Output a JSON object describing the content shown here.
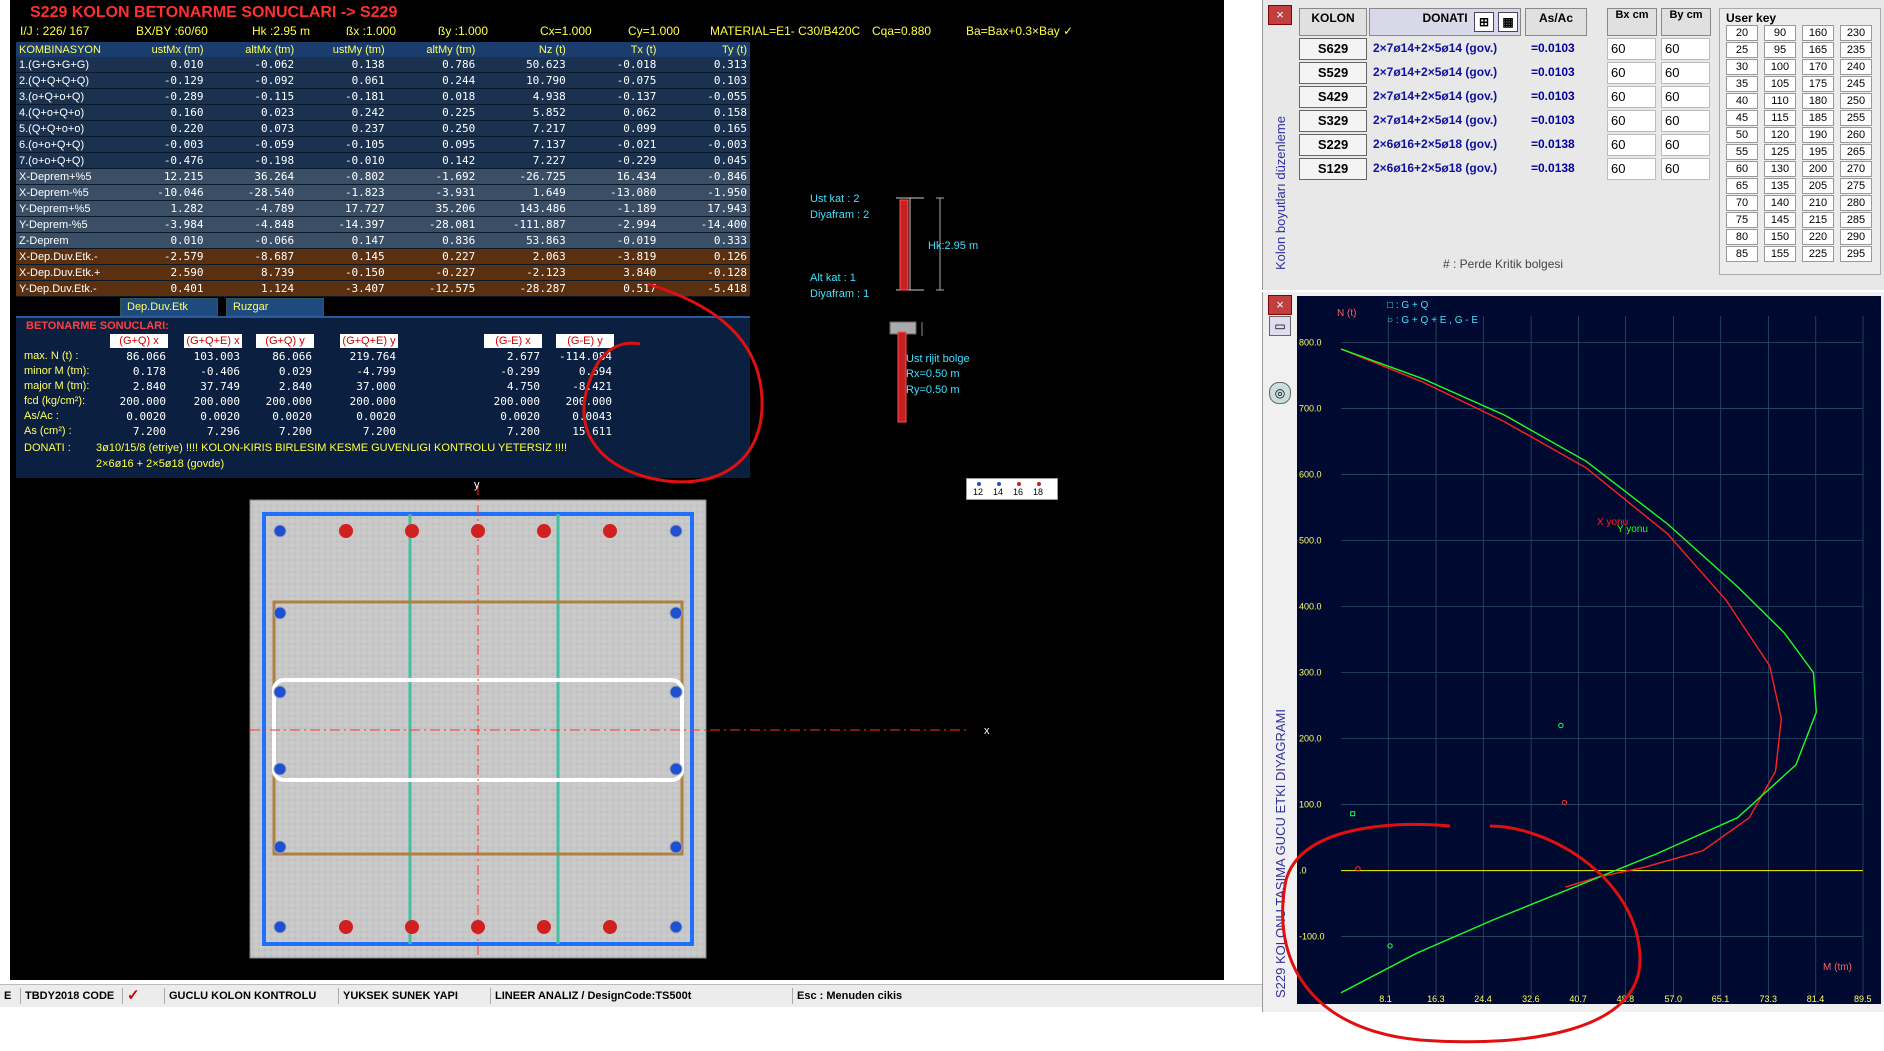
{
  "header": {
    "title": "S229 KOLON BETONARME SONUCLARI  ->  S229",
    "info": [
      "I/J : 226/ 167",
      "BX/BY :60/60",
      "Hk :2.95 m",
      "ßx :1.000",
      "ßy :1.000",
      "Cx=1.000",
      "Cy=1.000",
      "MATERIAL=E1-  C30/B420C",
      "Cqa=0.880",
      "Ba=Bax+0.3×Bay  ✓"
    ]
  },
  "combo_table": {
    "headers": [
      "KOMBINASYON",
      "ustMx (tm)",
      "altMx (tm)",
      "ustMy (tm)",
      "altMy (tm)",
      "Nz (t)",
      "Tx (t)",
      "Ty (t)"
    ],
    "rows": [
      {
        "cells": [
          "1.(G+G+G+G)",
          "0.010",
          "-0.062",
          "0.138",
          "0.786",
          "50.623",
          "-0.018",
          "0.313"
        ],
        "group": "a"
      },
      {
        "cells": [
          "2.(Q+Q+Q+Q)",
          "-0.129",
          "-0.092",
          "0.061",
          "0.244",
          "10.790",
          "-0.075",
          "0.103"
        ],
        "group": "a"
      },
      {
        "cells": [
          "3.(o+Q+o+Q)",
          "-0.289",
          "-0.115",
          "-0.181",
          "0.018",
          "4.938",
          "-0.137",
          "-0.055"
        ],
        "group": "a"
      },
      {
        "cells": [
          "4.(Q+o+Q+o)",
          "0.160",
          "0.023",
          "0.242",
          "0.225",
          "5.852",
          "0.062",
          "0.158"
        ],
        "group": "a"
      },
      {
        "cells": [
          "5.(Q+Q+o+o)",
          "0.220",
          "0.073",
          "0.237",
          "0.250",
          "7.217",
          "0.099",
          "0.165"
        ],
        "group": "a"
      },
      {
        "cells": [
          "6.(o+o+Q+Q)",
          "-0.003",
          "-0.059",
          "-0.105",
          "0.095",
          "7.137",
          "-0.021",
          "-0.003"
        ],
        "group": "a"
      },
      {
        "cells": [
          "7.(o+o+Q+Q)",
          "-0.476",
          "-0.198",
          "-0.010",
          "0.142",
          "7.227",
          "-0.229",
          "0.045"
        ],
        "group": "a"
      },
      {
        "cells": [
          "X-Deprem+%5",
          "12.215",
          "36.264",
          "-0.802",
          "-1.692",
          "-26.725",
          "16.434",
          "-0.846"
        ],
        "group": "b"
      },
      {
        "cells": [
          "X-Deprem-%5",
          "-10.046",
          "-28.540",
          "-1.823",
          "-3.931",
          "1.649",
          "-13.080",
          "-1.950"
        ],
        "group": "b"
      },
      {
        "cells": [
          "Y-Deprem+%5",
          "1.282",
          "-4.789",
          "17.727",
          "35.206",
          "143.486",
          "-1.189",
          "17.943"
        ],
        "group": "b"
      },
      {
        "cells": [
          "Y-Deprem-%5",
          "-3.984",
          "-4.848",
          "-14.397",
          "-28.081",
          "-111.887",
          "-2.994",
          "-14.400"
        ],
        "group": "b"
      },
      {
        "cells": [
          "Z-Deprem",
          "0.010",
          "-0.066",
          "0.147",
          "0.836",
          "53.863",
          "-0.019",
          "0.333"
        ],
        "group": "b"
      },
      {
        "cells": [
          "X-Dep.Duv.Etk.-",
          "-2.579",
          "-8.687",
          "0.145",
          "0.227",
          "2.063",
          "-3.819",
          "0.126"
        ],
        "group": "c"
      },
      {
        "cells": [
          "X-Dep.Duv.Etk.+",
          "2.590",
          "8.739",
          "-0.150",
          "-0.227",
          "-2.123",
          "3.840",
          "-0.128"
        ],
        "group": "c"
      },
      {
        "cells": [
          "Y-Dep.Duv.Etk.-",
          "0.401",
          "1.124",
          "-3.407",
          "-12.575",
          "-28.287",
          "0.517",
          "-5.418"
        ],
        "group": "c"
      }
    ],
    "tabs": [
      "Dep.Duv.Etk",
      "Ruzgar"
    ]
  },
  "results": {
    "title": "BETONARME SONUCLARI:",
    "col_heads": [
      "(G+Q) x",
      "(G+Q+E) x",
      "(G+Q) y",
      "(G+Q+E) y",
      "(G-E) x",
      "(G-E) y"
    ],
    "rows": [
      {
        "label": "max. N       (t)   :",
        "values": [
          "86.066",
          "103.003",
          "86.066",
          "219.764",
          "2.677",
          "-114.084"
        ]
      },
      {
        "label": "minor M    (tm):",
        "values": [
          "0.178",
          "-0.406",
          "0.029",
          "-4.799",
          "-0.299",
          "0.694"
        ]
      },
      {
        "label": "major M   (tm):",
        "values": [
          "2.840",
          "37.749",
          "2.840",
          "37.000",
          "4.750",
          "-8.421"
        ]
      },
      {
        "label": "fcd   (kg/cm²):",
        "values": [
          "200.000",
          "200.000",
          "200.000",
          "200.000",
          "200.000",
          "200.000"
        ]
      },
      {
        "label": "As/Ac         :",
        "values": [
          "0.0020",
          "0.0020",
          "0.0020",
          "0.0020",
          "0.0020",
          "0.0043"
        ]
      },
      {
        "label": "As       (cm²) :",
        "values": [
          "7.200",
          "7.296",
          "7.200",
          "7.200",
          "7.200",
          "15.611"
        ]
      }
    ],
    "donati_label": "DONATI    :",
    "donati_line1": "3ø10/15/8 (etriye)   !!!! KOLON-KIRIS BIRLESIM KESME GUVENLIGI KONTROLU YETERSIZ !!!!",
    "donati_line2": "2×6ø16 + 2×5ø18 (govde)"
  },
  "column_elevation": {
    "ust_kat": "Ust kat : 2",
    "ust_diyafram": "Diyafram : 2",
    "alt_kat": "Alt kat : 1",
    "alt_diyafram": "Diyafram : 1",
    "hk": "Hk:2.95 m",
    "rijit": "Ust rijit bolge",
    "rx": "Rx=0.50 m",
    "ry": "Ry=0.50 m"
  },
  "bar_legend": [
    "12",
    "14",
    "16",
    "18"
  ],
  "section": {
    "x_label": "x",
    "y_label": "y"
  },
  "sidebar": {
    "headers": {
      "kolon": "KOLON",
      "donati": "DONATI",
      "asac": "As/Ac",
      "bx": "Bx cm",
      "by": "By cm",
      "userkey": "User key"
    },
    "vertical_label": "Kolon boyutları düzenleme",
    "items": [
      {
        "name": "S629",
        "donati": "2×7ø14+2×5ø14 (gov.)",
        "asac": "=0.0103",
        "bx": "60",
        "by": "60"
      },
      {
        "name": "S529",
        "donati": "2×7ø14+2×5ø14 (gov.)",
        "asac": "=0.0103",
        "bx": "60",
        "by": "60"
      },
      {
        "name": "S429",
        "donati": "2×7ø14+2×5ø14 (gov.)",
        "asac": "=0.0103",
        "bx": "60",
        "by": "60"
      },
      {
        "name": "S329",
        "donati": "2×7ø14+2×5ø14 (gov.)",
        "asac": "=0.0103",
        "bx": "60",
        "by": "60"
      },
      {
        "name": "S229",
        "donati": "2×6ø16+2×5ø18 (gov.)",
        "asac": "=0.0138",
        "bx": "60",
        "by": "60"
      },
      {
        "name": "S129",
        "donati": "2×6ø16+2×5ø18 (gov.)",
        "asac": "=0.0138",
        "bx": "60",
        "by": "60"
      }
    ],
    "note": "# : Perde Kritik bolgesi",
    "user_keys": [
      [
        "20",
        "90",
        "160",
        "230"
      ],
      [
        "25",
        "95",
        "165",
        "235"
      ],
      [
        "30",
        "100",
        "170",
        "240"
      ],
      [
        "35",
        "105",
        "175",
        "245"
      ],
      [
        "40",
        "110",
        "180",
        "250"
      ],
      [
        "45",
        "115",
        "185",
        "255"
      ],
      [
        "50",
        "120",
        "190",
        "260"
      ],
      [
        "55",
        "125",
        "195",
        "265"
      ],
      [
        "60",
        "130",
        "200",
        "270"
      ],
      [
        "65",
        "135",
        "205",
        "275"
      ],
      [
        "70",
        "140",
        "210",
        "280"
      ],
      [
        "75",
        "145",
        "215",
        "285"
      ],
      [
        "80",
        "150",
        "220",
        "290"
      ],
      [
        "85",
        "155",
        "225",
        "295"
      ]
    ]
  },
  "diagram": {
    "vertical_label": "S229 KOLONU TASIMA GUCU ETKI DIYAGRAMI",
    "legend1": "□ : G + Q",
    "legend2": "○ : G + Q + E ,  G - E",
    "x_axis_label": "M (tm)",
    "y_axis_label": "N (t)",
    "x_ticks": [
      "8.1",
      "16.3",
      "24.4",
      "32.6",
      "40.7",
      "48.8",
      "57.0",
      "65.1",
      "73.3",
      "81.4",
      "89.5"
    ],
    "y_ticks": [
      "800.0",
      "700.0",
      "600.0",
      "500.0",
      "400.0",
      "300.0",
      "200.0",
      "100.0",
      ".0",
      "-100.0"
    ],
    "curve_label_x": "X yonu",
    "curve_label_y": "Y yonu"
  },
  "chart_data": {
    "type": "line",
    "title": "S229 KOLONU TASIMA GUCU ETKI DIYAGRAMI",
    "xlabel": "M (tm)",
    "ylabel": "N (t)",
    "xlim": [
      0,
      89.5
    ],
    "ylim": [
      -190,
      840
    ],
    "grid": true,
    "series": [
      {
        "name": "X yonu",
        "color": "#ff2020",
        "x": [
          0,
          14,
          28,
          42,
          56,
          66,
          73.5,
          75.5,
          74.5,
          70,
          62,
          52,
          44,
          38.5
        ],
        "y": [
          790,
          740,
          680,
          610,
          510,
          410,
          310,
          230,
          150,
          80,
          30,
          5,
          -10,
          -25
        ]
      },
      {
        "name": "Y yonu",
        "color": "#20ff20",
        "x": [
          0,
          14,
          28,
          42,
          56,
          68,
          76,
          81,
          81.5,
          78,
          68,
          54,
          40,
          26,
          13,
          0
        ],
        "y": [
          790,
          745,
          690,
          620,
          525,
          430,
          360,
          300,
          240,
          160,
          80,
          25,
          -25,
          -75,
          -125,
          -185
        ]
      }
    ],
    "points_gq": [
      {
        "x": 2.0,
        "y": 86.1
      }
    ],
    "points_gqe": [
      {
        "x": 2.9,
        "y": 2.7
      },
      {
        "x": 37.7,
        "y": 219.8
      },
      {
        "x": 8.4,
        "y": -114.1
      },
      {
        "x": 38.3,
        "y": 103.0
      }
    ]
  },
  "statusbar": {
    "items": [
      "TBDY2018 CODE",
      "GUCLU KOLON KONTROLU",
      "YUKSEK SUNEK YAPI",
      "LINEER ANALIZ / DesignCode:TS500t",
      "Esc : Menuden cikis"
    ]
  }
}
